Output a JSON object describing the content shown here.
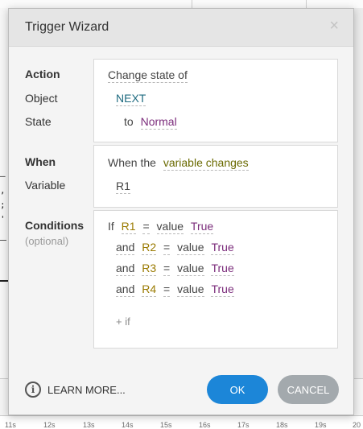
{
  "background": {
    "ruler_ticks": [
      "11s",
      "12s",
      "13s",
      "14s",
      "15s",
      "16s",
      "17s",
      "18s",
      "19s",
      "20"
    ]
  },
  "dialog": {
    "title": "Trigger Wizard",
    "close_glyph": "×",
    "sections": {
      "action": {
        "label": "Action",
        "object_label": "Object",
        "state_label": "State",
        "change_text": "Change state of",
        "object_value": "NEXT",
        "to_text": "to",
        "state_value": "Normal"
      },
      "when": {
        "label": "When",
        "variable_label": "Variable",
        "when_text": "When the",
        "event_value": "variable changes",
        "variable_value": "R1"
      },
      "conditions": {
        "label": "Conditions",
        "sublabel": "(optional)",
        "rows": [
          {
            "conj": "If",
            "var": "R1",
            "op": "=",
            "kind": "value",
            "val": "True"
          },
          {
            "conj": "and",
            "var": "R2",
            "op": "=",
            "kind": "value",
            "val": "True"
          },
          {
            "conj": "and",
            "var": "R3",
            "op": "=",
            "kind": "value",
            "val": "True"
          },
          {
            "conj": "and",
            "var": "R4",
            "op": "=",
            "kind": "value",
            "val": "True"
          }
        ],
        "add_if": "+ if"
      }
    },
    "footer": {
      "learn_more": "LEARN MORE...",
      "info_glyph": "i",
      "ok_label": "OK",
      "cancel_label": "CANCEL"
    },
    "colors": {
      "ok_button": "#1c86d8",
      "cancel_button": "#a3a9ad",
      "object_token": "#1f6b80",
      "state_token": "#7b2c7b",
      "event_token": "#6a6a00",
      "variable_token": "#9a7a00"
    }
  }
}
